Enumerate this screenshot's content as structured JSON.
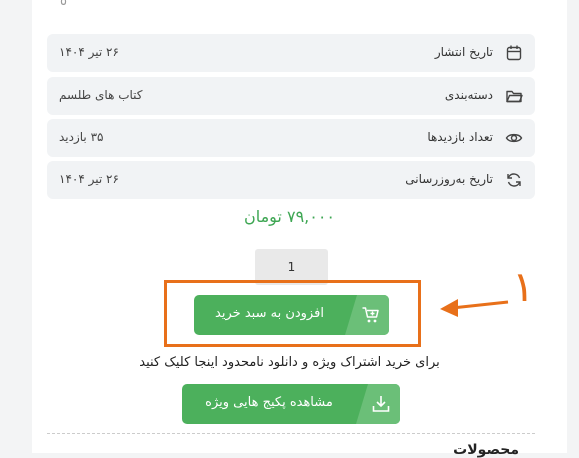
{
  "top_fragment": "٥",
  "meta": [
    {
      "label": "تاریخ انتشار",
      "value": "۲۶ تیر ۱۴۰۴",
      "icon": "calendar-icon"
    },
    {
      "label": "دسته‌بندی",
      "value": "کتاب های طلسم",
      "icon": "folder-icon"
    },
    {
      "label": "تعداد بازدیدها",
      "value": "۳۵ بازدید",
      "icon": "eye-icon"
    },
    {
      "label": "تاریخ به‌روزرسانی",
      "value": "۲۶ تیر ۱۴۰۴",
      "icon": "refresh-icon"
    }
  ],
  "price": "۷۹,۰۰۰ تومان",
  "quantity": "1",
  "add_to_cart_label": "افزودن به سبد خرید",
  "subscription_info": "برای خرید اشتراک ویژه و دانلود نامحدود اینجا کلیک کنید",
  "packages_button_label": "مشاهده پکیج هایی ویژه",
  "bottom_heading": "محصولات",
  "annotation": {
    "number": "۱",
    "color": "#e8701a"
  },
  "colors": {
    "accent_green": "#4cb05c",
    "price_green": "#3ea653",
    "annotation_orange": "#e8701a"
  }
}
